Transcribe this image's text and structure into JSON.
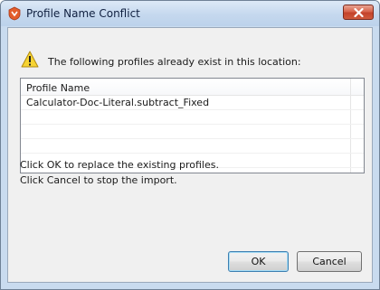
{
  "window": {
    "title": "Profile Name Conflict",
    "icons": {
      "app": "app-logo-icon",
      "close": "close-icon",
      "warning": "warning-icon"
    }
  },
  "message": "The following profiles already exist in this location:",
  "table": {
    "column_header": "Profile Name",
    "rows": [
      "Calculator-Doc-Literal.subtract_Fixed"
    ]
  },
  "hints": {
    "ok": "Click OK to replace the existing profiles.",
    "cancel": "Click Cancel to stop the import."
  },
  "buttons": {
    "ok": "OK",
    "cancel": "Cancel"
  },
  "colors": {
    "title_bar": "#c5d8ee",
    "close_button": "#c4432b",
    "dialog_body": "#f0f0f0"
  }
}
